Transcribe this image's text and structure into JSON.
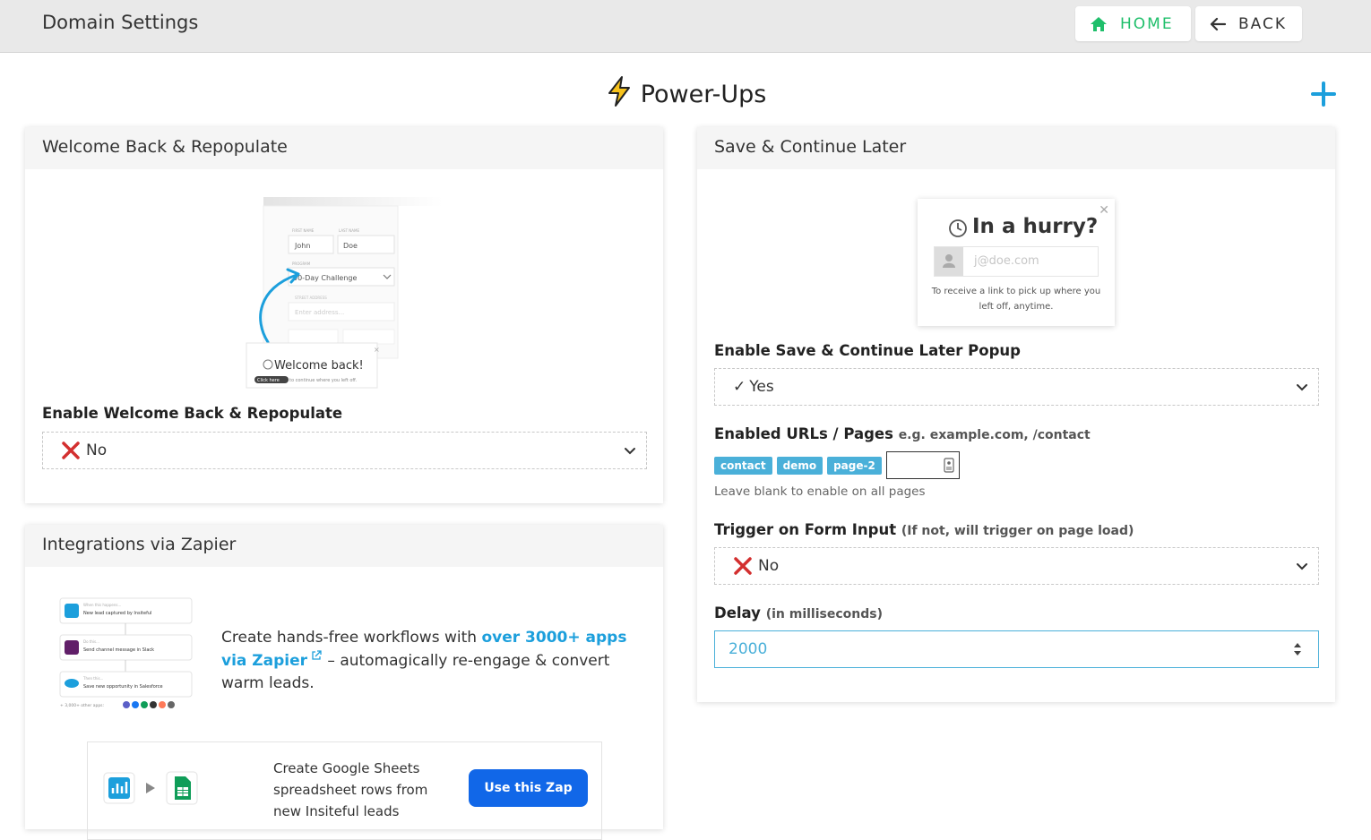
{
  "header": {
    "title": "Domain Settings",
    "home_label": "HOME",
    "back_label": "BACK"
  },
  "page": {
    "heading": "Power-Ups"
  },
  "welcome": {
    "title": "Welcome Back & Repopulate",
    "illustration": {
      "first_name_label": "FIRST NAME",
      "last_name_label": "LAST NAME",
      "first_name": "John",
      "last_name": "Doe",
      "program_label": "PROGRAM",
      "program_value": "90-Day Challenge",
      "address_label": "STREET ADDRESS",
      "address_placeholder": "Enter address...",
      "popup_title": "Welcome back!",
      "popup_button": "Click here",
      "popup_text": "to continue where you left off."
    },
    "enable_label": "Enable Welcome Back & Repopulate",
    "enable_value": "No"
  },
  "zapier": {
    "title": "Integrations via Zapier",
    "flow": {
      "step1_caption": "When this happens...",
      "step1": "New lead captured by Insiteful",
      "step2_caption": "Do this...",
      "step2": "Send channel message in Slack",
      "step3_caption": "Then this...",
      "step3": "Save new opportunity in Salesforce",
      "more": "+ 3,000+ other apps:"
    },
    "desc_prefix": "Create hands-free workflows with ",
    "desc_link": "over 3000+ apps via Zapier",
    "desc_suffix": " – automagically re-engage & convert warm leads.",
    "zap_desc": "Create Google Sheets spreadsheet rows from new Insiteful leads",
    "zap_button": "Use this Zap"
  },
  "save": {
    "title": "Save & Continue Later",
    "popup": {
      "title": "In a hurry?",
      "placeholder": "j@doe.com",
      "text": "To receive a link to pick up where you left off, anytime."
    },
    "enable_label": "Enable Save & Continue Later Popup",
    "enable_value": "Yes",
    "urls_label": "Enabled URLs / Pages",
    "urls_hint": "e.g. example.com, /contact",
    "tags": [
      "contact",
      "demo",
      "page-2"
    ],
    "urls_help": "Leave blank to enable on all pages",
    "trigger_label": "Trigger on Form Input",
    "trigger_hint": "(If not, will trigger on page load)",
    "trigger_value": "No",
    "delay_label": "Delay",
    "delay_hint": "(in milliseconds)",
    "delay_value": "2000"
  },
  "colors": {
    "accent": "#1c9fdc",
    "home_green": "#1fbf6b",
    "tag_blue": "#4ab0d9",
    "zap_button": "#1167e8",
    "error_red": "#d32f2f"
  }
}
